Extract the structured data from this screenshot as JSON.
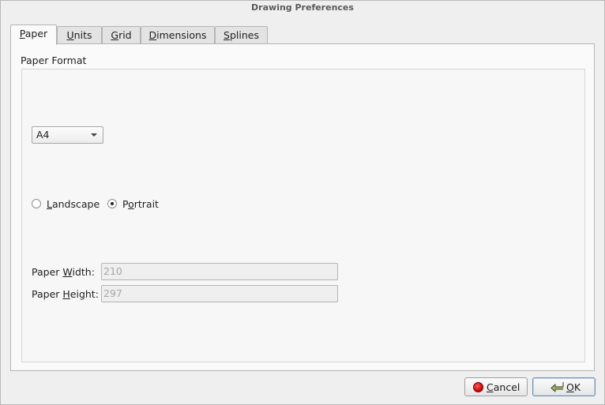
{
  "window": {
    "title": "Drawing Preferences"
  },
  "tabs": [
    {
      "label": "Paper",
      "mnemonic": "P",
      "rest": "aper",
      "active": true
    },
    {
      "label": "Units",
      "mnemonic": "U",
      "rest": "nits",
      "active": false
    },
    {
      "label": "Grid",
      "mnemonic": "G",
      "rest": "rid",
      "active": false
    },
    {
      "label": "Dimensions",
      "mnemonic": "D",
      "rest": "imensions",
      "active": false
    },
    {
      "label": "Splines",
      "mnemonic": "S",
      "rest": "plines",
      "active": false
    }
  ],
  "paper": {
    "group_title": "Paper Format",
    "format_selected": "A4",
    "orientation": {
      "landscape_label_m": "L",
      "landscape_label_rest": "andscape",
      "portrait_label_pre": "P",
      "portrait_label_m": "o",
      "portrait_label_rest": "rtrait",
      "selected": "Portrait"
    },
    "width_label_pre": "Paper ",
    "width_label_m": "W",
    "width_label_rest": "idth:",
    "width_value": "210",
    "height_label_pre": "Paper ",
    "height_label_m": "H",
    "height_label_rest": "eight:",
    "height_value": "297"
  },
  "buttons": {
    "cancel_m": "C",
    "cancel_rest": "ancel",
    "ok_m": "O",
    "ok_rest": "K"
  },
  "colors": {
    "cancel_icon": "#d40000",
    "ok_icon": "#6b7f4a"
  }
}
